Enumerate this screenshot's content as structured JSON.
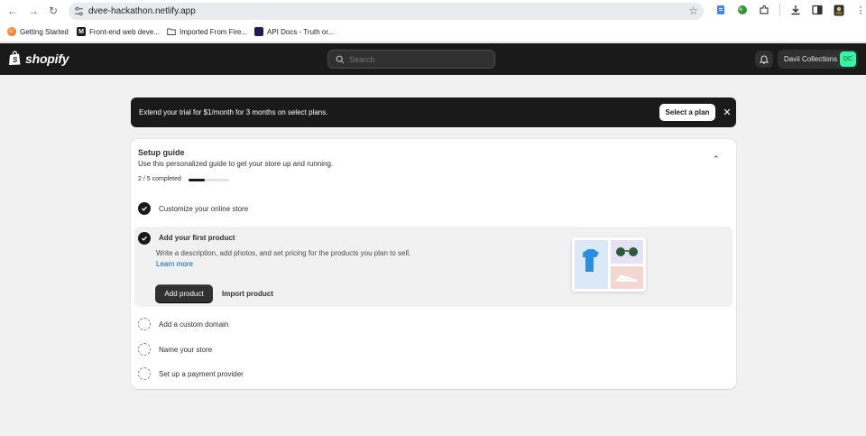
{
  "browser": {
    "url": "dvee-hackathon.netlify.app",
    "bookmarks": [
      {
        "label": "Getting Started"
      },
      {
        "label": "Front-end web deve..."
      },
      {
        "label": "Imported From Fire..."
      },
      {
        "label": "API Docs - Truth or..."
      }
    ]
  },
  "header": {
    "logo_text": "shopify",
    "search_placeholder": "Search",
    "store_name": "Davii Collections",
    "avatar_initials": "DC",
    "avatar_color": "#36f4a4"
  },
  "banner": {
    "text": "Extend your trial for $1/month for 3 months on select plans.",
    "button_label": "Select a plan"
  },
  "setup_guide": {
    "title": "Setup guide",
    "subtitle": "Use this personalized guide to get your store up and running.",
    "progress_text": "2 / 5 completed",
    "progress_fraction": 0.4,
    "steps": [
      {
        "label": "Customize your online store",
        "completed": true
      },
      {
        "label": "Add your first product",
        "completed": true
      },
      {
        "label": "Add a custom domain",
        "completed": false
      },
      {
        "label": "Name your store",
        "completed": false
      },
      {
        "label": "Set up a payment provider",
        "completed": false
      }
    ],
    "active_step": {
      "title": "Add your first product",
      "description": "Write a description, add photos, and set pricing for the products you plan to sell.",
      "learn_more": "Learn more",
      "primary_button": "Add product",
      "secondary_button": "Import product"
    }
  }
}
